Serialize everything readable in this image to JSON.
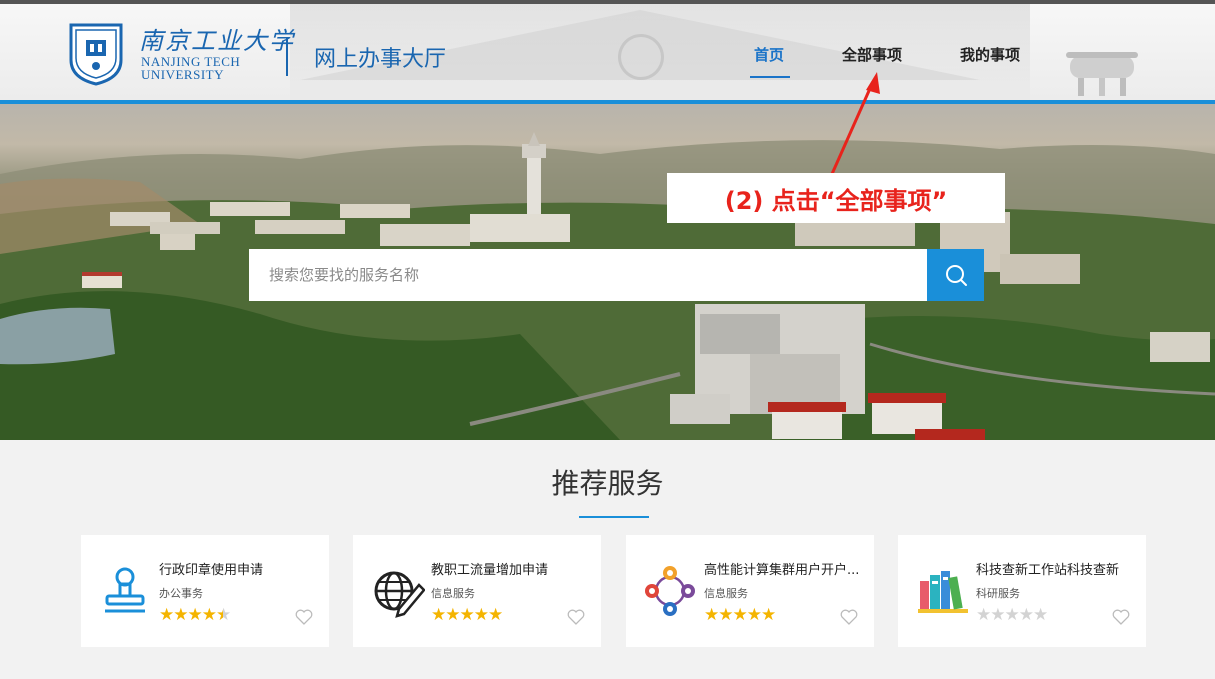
{
  "header": {
    "logo_cn": "南京工业大学",
    "logo_en_line1": "NANJING TECH",
    "logo_en_line2": "UNIVERSITY",
    "site_title": "网上办事大厅",
    "nav": [
      {
        "label": "首页",
        "active": true
      },
      {
        "label": "全部事项",
        "active": false
      },
      {
        "label": "我的事项",
        "active": false
      }
    ]
  },
  "hero": {
    "search_placeholder": "搜索您要找的服务名称",
    "search_icon": "magnifier-icon"
  },
  "annotation": {
    "text": "(2) 点击“全部事项”",
    "color": "#e8231c"
  },
  "recommended": {
    "title": "推荐服务",
    "cards": [
      {
        "title": "行政印章使用申请",
        "category": "办公事务",
        "rating": 4.5,
        "icon": "stamp-icon"
      },
      {
        "title": "教职工流量增加申请",
        "category": "信息服务",
        "rating": 5,
        "icon": "globe-pen-icon"
      },
      {
        "title": "高性能计算集群用户开户...",
        "category": "信息服务",
        "rating": 5,
        "icon": "network-nodes-icon"
      },
      {
        "title": "科技查新工作站科技查新",
        "category": "科研服务",
        "rating": 0,
        "icon": "books-icon"
      }
    ]
  },
  "colors": {
    "accent": "#1a8fd9",
    "brand": "#1a66b0",
    "star": "#f4b400"
  }
}
